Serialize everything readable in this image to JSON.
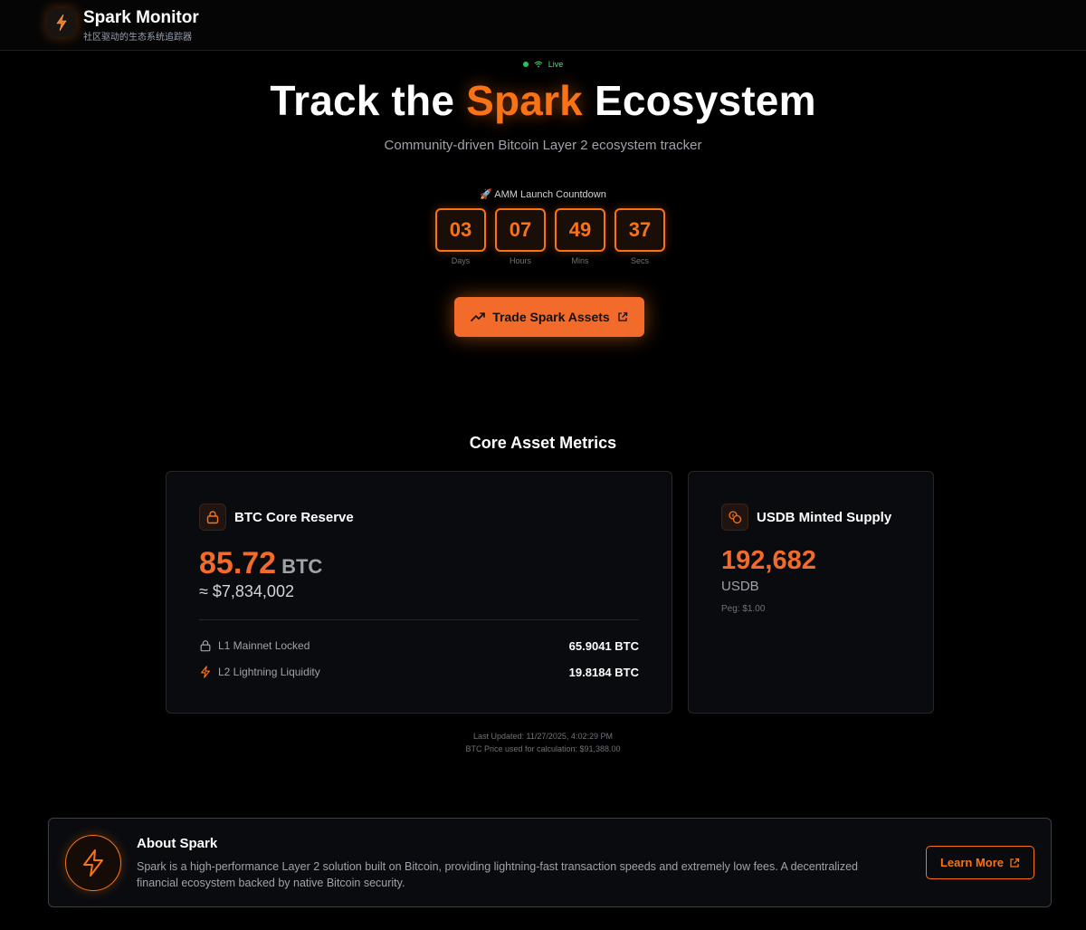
{
  "header": {
    "brand_title": "Spark Monitor",
    "brand_subtitle": "社区驱动的生态系统追踪器",
    "logo_icon": "lightning-icon"
  },
  "hero": {
    "live_label": "Live",
    "title_prefix": "Track the ",
    "title_accent": "Spark",
    "title_suffix": " Ecosystem",
    "subtitle": "Community-driven Bitcoin Layer 2 ecosystem tracker"
  },
  "countdown": {
    "label": "🚀 AMM Launch Countdown",
    "units": [
      {
        "value": "03",
        "caption": "Days"
      },
      {
        "value": "07",
        "caption": "Hours"
      },
      {
        "value": "49",
        "caption": "Mins"
      },
      {
        "value": "37",
        "caption": "Secs"
      }
    ]
  },
  "trade_button": {
    "label": "Trade Spark Assets"
  },
  "metrics": {
    "section_title": "Core Asset Metrics",
    "btc": {
      "title": "BTC Core Reserve",
      "value": "85.72",
      "unit": "BTC",
      "usd_value": "≈ $7,834,002",
      "rows": [
        {
          "label": "L1 Mainnet Locked",
          "value": "65.9041 BTC",
          "icon": "lock-icon"
        },
        {
          "label": "L2 Lightning Liquidity",
          "value": "19.8184 BTC",
          "icon": "lightning-icon"
        }
      ]
    },
    "usdb": {
      "title": "USDB Minted Supply",
      "value": "192,682",
      "unit": "USDB",
      "peg": "Peg: $1.00"
    },
    "last_updated": "Last Updated: 11/27/2025, 4:02:29 PM",
    "btc_price_note": "BTC Price used for calculation: $91,388.00"
  },
  "about": {
    "title": "About Spark",
    "text": "Spark is a high-performance Layer 2 solution built on Bitcoin, providing lightning-fast transaction speeds and extremely low fees. A decentralized financial ecosystem backed by native Bitcoin security.",
    "button_label": "Learn More"
  },
  "colors": {
    "accent": "#f97316",
    "background": "#000000",
    "card": "#0a0b0f",
    "live": "#22c55e"
  }
}
